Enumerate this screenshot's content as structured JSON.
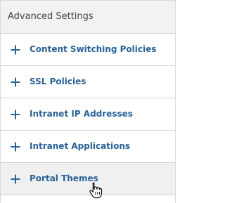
{
  "panel": {
    "title": "Advanced Settings",
    "items": [
      {
        "label": "Content Switching Policies",
        "icon": "plus-icon"
      },
      {
        "label": "SSL Policies",
        "icon": "plus-icon"
      },
      {
        "label": "Intranet IP Addresses",
        "icon": "plus-icon"
      },
      {
        "label": "Intranet Applications",
        "icon": "plus-icon"
      },
      {
        "label": "Portal Themes",
        "icon": "plus-icon",
        "hovered": true
      }
    ]
  },
  "colors": {
    "link_blue": "#2a6296",
    "header_bg": "#f2f2f2",
    "hover_bg": "#f0f0f0",
    "divider": "#d4d4d4"
  },
  "cursor": {
    "icon": "hand-pointer-cursor-icon"
  }
}
